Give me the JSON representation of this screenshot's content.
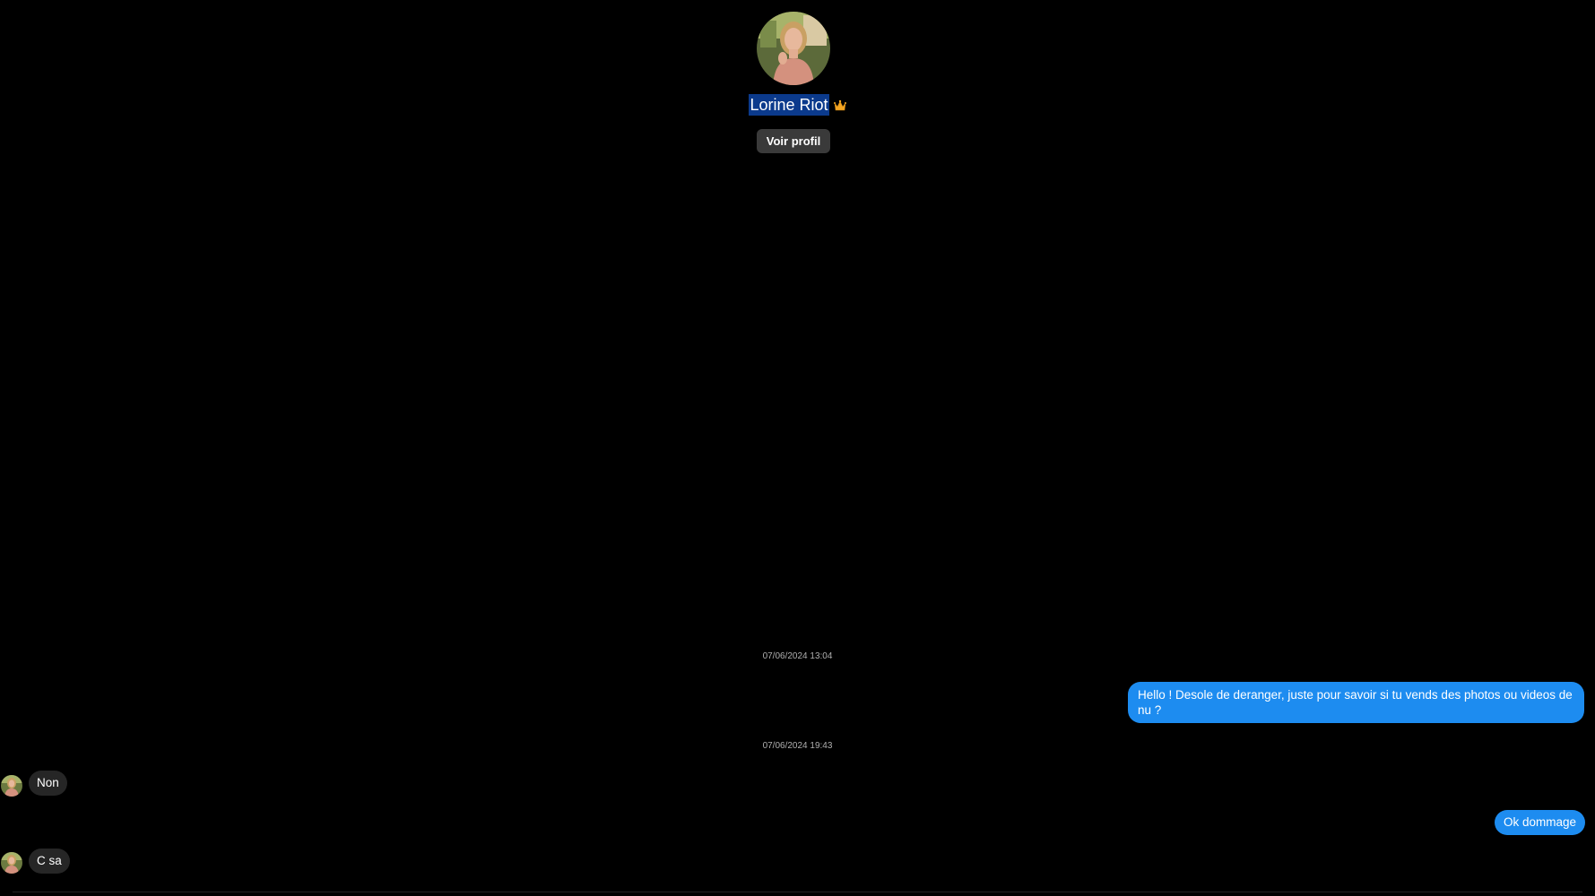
{
  "header": {
    "display_name": "Lorine Riot",
    "badge_icon": "crown-icon",
    "view_profile_label": "Voir profil"
  },
  "conversation": {
    "timestamp_1": "07/06/2024 13:04",
    "message_out_1": "Hello ! Desole de deranger, juste pour savoir si tu vends des photos ou videos de nu ?",
    "timestamp_2": "07/06/2024 19:43",
    "message_in_1": "Non",
    "message_out_2": "Ok dommage",
    "message_in_2": "C sa"
  },
  "colors": {
    "background": "#000000",
    "outgoing_bubble": "#1d8cf0",
    "incoming_bubble": "#262626",
    "button": "#3a3a3a",
    "name_highlight": "#0b3a8c",
    "timestamp_text": "#b0b0b0"
  }
}
